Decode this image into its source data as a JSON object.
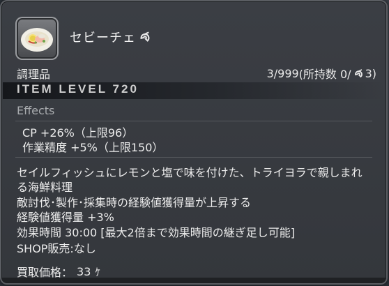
{
  "item": {
    "name": "セビーチェ",
    "category": "調理品",
    "stack_count": "3/999",
    "owned_prefix": "(所持数 0/",
    "owned_hq": "3)",
    "item_level": "ITEM LEVEL 720"
  },
  "effects": {
    "heading": "Effects",
    "lines": [
      "CP +26%（上限96）",
      "作業精度 +5%（上限150）"
    ]
  },
  "description": {
    "lines": [
      "セイルフィッシュにレモンと塩で味を付けた、トライヨラで親しまれ",
      "る海鮮料理",
      "敵討伐･製作･採集時の経験値獲得量が上昇する",
      "経験値獲得量 +3%",
      "効果時間 30:00 [最大2倍まで効果時間の継ぎ足し可能]",
      "SHOP販売:なし"
    ]
  },
  "price": {
    "label": "買取価格：",
    "value": "33",
    "currency_icon": "gil-icon"
  },
  "colors": {
    "text": "#ececec",
    "muted": "#a9acaf",
    "panel": "#3b3e44"
  }
}
